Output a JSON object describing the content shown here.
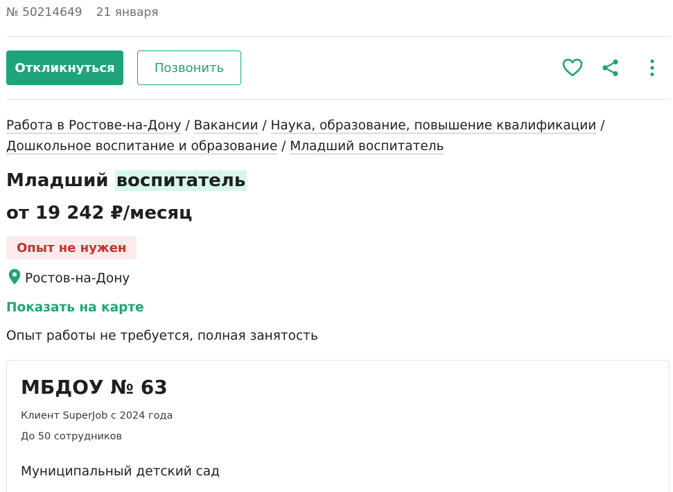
{
  "meta": {
    "vacancy_number": "№ 50214649",
    "date": "21 января"
  },
  "actions": {
    "respond_label": "Откликнуться",
    "call_label": "Позвонить",
    "icons": [
      "heart-icon",
      "share-icon",
      "more-vertical-icon"
    ]
  },
  "breadcrumb": {
    "items": [
      "Работа в Ростове-на-Дону",
      "Вакансии",
      "Наука, образование, повышение квалификации",
      "Дошкольное воспитание и образование",
      "Младший воспитатель"
    ],
    "separator": "/"
  },
  "vacancy": {
    "title_part1": "Младший",
    "title_part2": "воспитатель",
    "salary": "от 19 242 ₽/месяц",
    "experience_badge": "Опыт не нужен",
    "city": "Ростов-на-Дону",
    "map_link": "Показать на карте",
    "conditions": "Опыт работы не требуется, полная занятость"
  },
  "company": {
    "name": "МБДОУ № 63",
    "client_since": "Клиент SuperJob с 2024 года",
    "size": "До 50 сотрудников",
    "description": "Муниципальный детский сад"
  },
  "colors": {
    "accent": "#1fa37a",
    "badge_bg": "#fdeaea",
    "badge_text": "#c4302b",
    "highlight": "#d7f7ea"
  }
}
